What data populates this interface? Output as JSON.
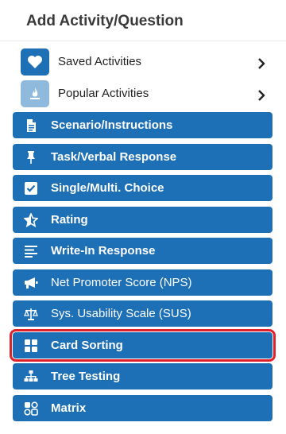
{
  "header": {
    "title": "Add Activity/Question"
  },
  "links": [
    {
      "label": "Saved Activities",
      "icon": "heart-icon",
      "icon_bg": "#1d6fb6"
    },
    {
      "label": "Popular Activities",
      "icon": "flame-icon",
      "icon_bg": "#8fb9dd"
    }
  ],
  "activity_types": [
    {
      "label": "Scenario/Instructions",
      "icon": "document-icon"
    },
    {
      "label": "Task/Verbal Response",
      "icon": "pin-icon"
    },
    {
      "label": "Single/Multi. Choice",
      "icon": "checkbox-icon"
    },
    {
      "label": "Rating",
      "icon": "star-icon"
    },
    {
      "label": "Write-In Response",
      "icon": "text-lines-icon"
    },
    {
      "label": "Net Promoter Score (NPS)",
      "icon": "megaphone-icon"
    },
    {
      "label": "Sys. Usability Scale (SUS)",
      "icon": "scale-icon"
    },
    {
      "label": "Card Sorting",
      "icon": "grid-icon",
      "selected": true
    },
    {
      "label": "Tree Testing",
      "icon": "hierarchy-icon"
    },
    {
      "label": "Matrix",
      "icon": "matrix-icon"
    }
  ],
  "colors": {
    "button": "#1d6fb6",
    "highlight": "#e0212b"
  }
}
